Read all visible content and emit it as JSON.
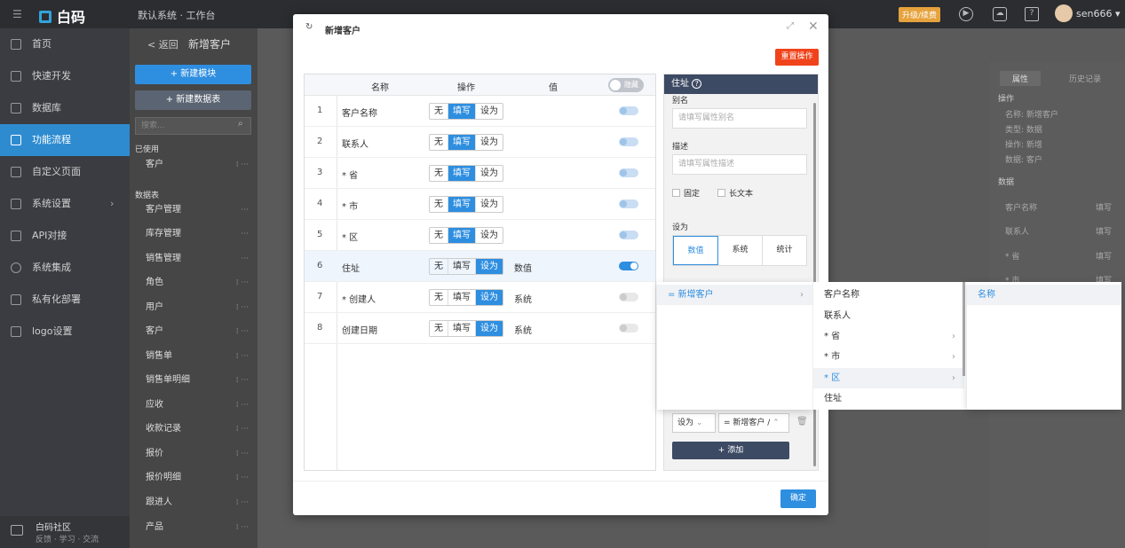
{
  "topbar": {
    "logo": "白码",
    "system": "默认系统 · 工作台",
    "upgrade": "升级/续费",
    "user": "sen666"
  },
  "sidebar": {
    "items": [
      {
        "label": "首页"
      },
      {
        "label": "快速开发"
      },
      {
        "label": "数据库"
      },
      {
        "label": "功能流程"
      },
      {
        "label": "自定义页面"
      },
      {
        "label": "系统设置"
      },
      {
        "label": "API对接"
      },
      {
        "label": "系统集成"
      },
      {
        "label": "私有化部署"
      },
      {
        "label": "logo设置"
      }
    ],
    "footer_title": "白码社区",
    "footer_sub": "反馈 · 学习 · 交流"
  },
  "modules": {
    "new_module": "+ 新建模块",
    "new_table": "+ 新建数据表",
    "search_placeholder": "搜索...",
    "used_head": "已使用",
    "used_item": "客户",
    "tables_head": "数据表",
    "items": [
      "客户管理",
      "库存管理",
      "销售管理",
      "角色",
      "用户",
      "客户",
      "销售单",
      "销售单明细",
      "应收",
      "收款记录",
      "报价",
      "报价明细",
      "跟进人",
      "产品"
    ]
  },
  "page": {
    "back": "< 返回",
    "title": "新增客户"
  },
  "right_panel": {
    "tab_attr": "属性",
    "tab_history": "历史记录",
    "op_head": "操作",
    "op_lines": [
      "名称: 新增客户",
      "类型: 数据",
      "操作: 新增",
      "数据: 客户"
    ],
    "data_head": "数据",
    "rows": [
      {
        "k": "客户名称",
        "v": "填写"
      },
      {
        "k": "联系人",
        "v": "填写"
      },
      {
        "k": "* 省",
        "v": "填写"
      },
      {
        "k": "* 市",
        "v": "填写"
      }
    ]
  },
  "modal": {
    "title": "新增客户",
    "reset": "重置操作",
    "ok": "确定",
    "table": {
      "col_name": "名称",
      "col_op": "操作",
      "col_val": "值",
      "hide_label": "隐藏",
      "seg_labels": [
        "无",
        "填写",
        "设为"
      ],
      "rows": [
        {
          "num": "1",
          "name": "客户名称",
          "op": "填写",
          "val": "",
          "sw": "light"
        },
        {
          "num": "2",
          "name": "联系人",
          "op": "填写",
          "val": "",
          "sw": "light"
        },
        {
          "num": "3",
          "name": "* 省",
          "op": "填写",
          "val": "",
          "sw": "light"
        },
        {
          "num": "4",
          "name": "* 市",
          "op": "填写",
          "val": "",
          "sw": "light"
        },
        {
          "num": "5",
          "name": "* 区",
          "op": "填写",
          "val": "",
          "sw": "light"
        },
        {
          "num": "6",
          "name": "住址",
          "op": "设为",
          "val": "数值",
          "sw": "on"
        },
        {
          "num": "7",
          "name": "* 创建人",
          "op": "设为",
          "val": "系统",
          "sw": "off"
        },
        {
          "num": "8",
          "name": "创建日期",
          "op": "设为",
          "val": "系统",
          "sw": "off"
        }
      ]
    },
    "prop": {
      "header": "住址",
      "alias_label": "别名",
      "alias_placeholder": "请填写属性别名",
      "desc_label": "描述",
      "desc_placeholder": "请填写属性描述",
      "fixed": "固定",
      "longtext": "长文本",
      "setas_label": "设为",
      "setas_options": [
        "数值",
        "系统",
        "统计"
      ],
      "setas_select": "设为",
      "path_select": "= 新增客户 /",
      "add": "+ 添加"
    },
    "cascader": {
      "col1": [
        "= 新增客户"
      ],
      "col2": [
        "客户名称",
        "联系人",
        "* 省",
        "* 市",
        "* 区",
        "住址"
      ],
      "col3": [
        "名称"
      ]
    }
  }
}
